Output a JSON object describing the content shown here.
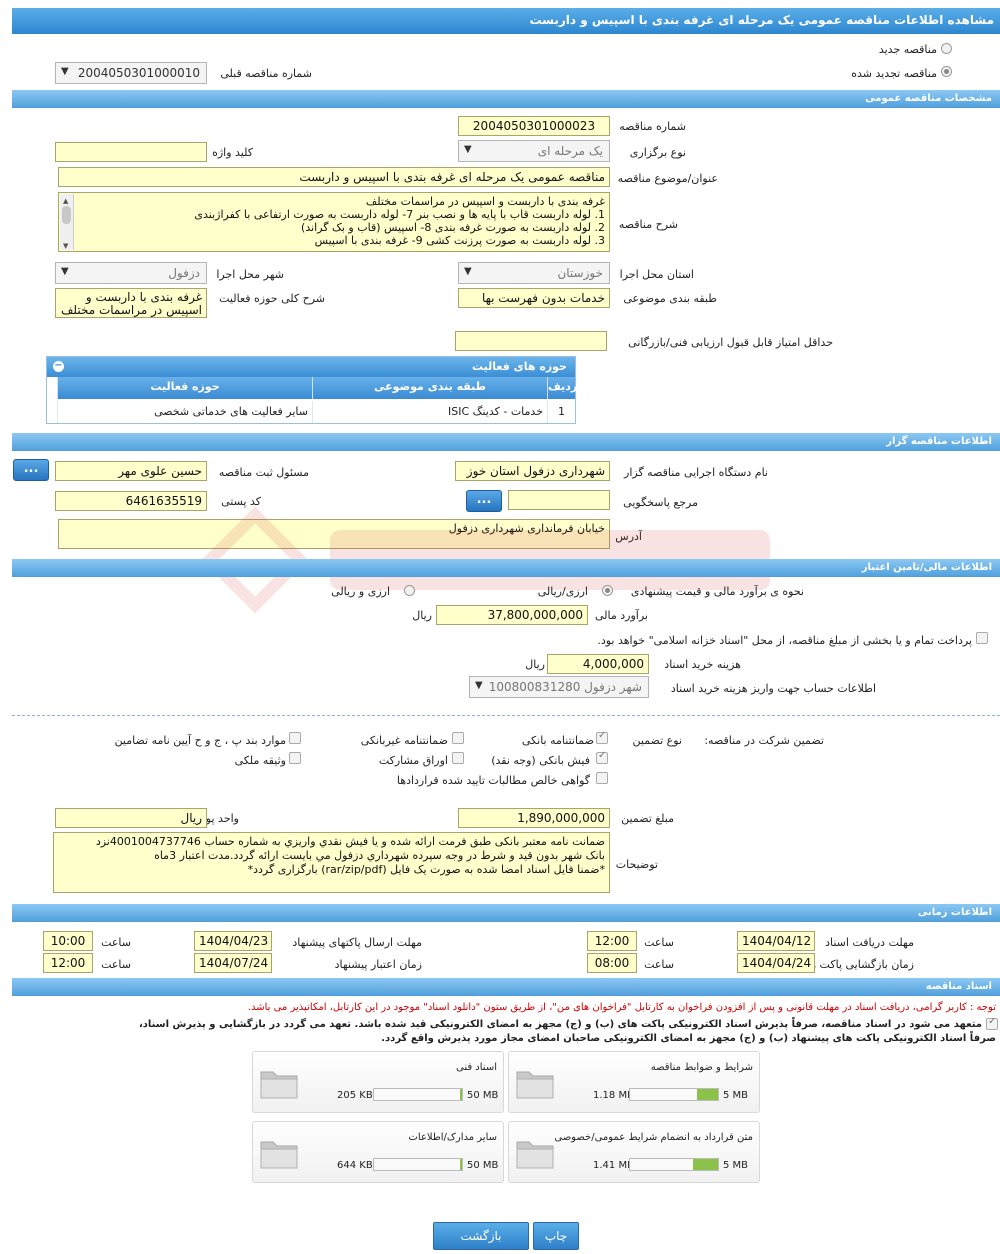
{
  "page": {
    "title": "مشاهده اطلاعات مناقصه عمومی یک مرحله ای غرفه بندی با اسپیس و داربست"
  },
  "tender_type": {
    "new_label": "مناقصه جدید",
    "renewed_label": "مناقصه تجدید شده",
    "prev_number_label": "شماره مناقصه قبلی",
    "prev_number_value": "2004050301000010"
  },
  "general": {
    "section_title": "مشخصات مناقصه عمومی",
    "number_label": "شماره مناقصه",
    "number_value": "2004050301000023",
    "holding_type_label": "نوع برگزاری",
    "holding_type_value": "یک مرحله ای",
    "keyword_label": "کلید واژه",
    "keyword_value": "",
    "subject_label": "عنوان/موضوع مناقصه",
    "subject_value": "مناقصه عمومی یک مرحله ای غرفه بندی با اسپیس و داربست",
    "description_label": "شرح مناقصه",
    "description_lines": [
      "غرفه بندی با داربست و اسپیس در مراسمات مختلف",
      "1.     لوله داربست قاب با پایه ها و نصب بنر       7-     لوله داربست به صورت ارتفاعی با کفراژبندی",
      "2.     لوله داربست به صورت غرفه بندی    8-      اسپیس (قاب و بک گراند)",
      "3.     لوله داربست به صورت پرزنت کشی  9-     غرفه بندی با اسپیس"
    ],
    "province_label": "استان محل اجرا",
    "province_value": "خوزستان",
    "city_label": "شهر محل اجرا",
    "city_value": "دزفول",
    "category_label": "طبقه بندی موضوعی",
    "category_value": "خدمات بدون فهرست بها",
    "activity_desc_label": "شرح کلی حوزه فعالیت",
    "activity_desc_lines": [
      "غرفه بندی با داربست و",
      "اسپیس در مراسمات مختلف"
    ],
    "min_score_label": "حداقل امتیاز قابل قبول ارزیابی فنی/بازرگانی",
    "min_score_value": ""
  },
  "activities": {
    "title": "حوزه های فعالیت",
    "columns": [
      "ردیف",
      "طبقه بندی موضوعی",
      "حوزه فعالیت"
    ],
    "rows": [
      {
        "index": "1",
        "category": "خدمات - کدینگ ISIC",
        "activity": "سایر فعالیت های خدماتی شخصی"
      }
    ]
  },
  "organizer": {
    "section_title": "اطلاعات مناقصه گزار",
    "org_label": "نام دستگاه اجرایی مناقصه گزار",
    "org_value": "شهرداری دزفول استان خوز",
    "responsible_label": "مسئول ثبت مناقصه",
    "responsible_value": "حسین علوی مهر",
    "reference_label": "مرجع پاسخگویی",
    "reference_value": "",
    "postal_label": "کد پستی",
    "postal_value": "6461635519",
    "address_label": "آدرس",
    "address_value": "خیابان فرمانداری شهرداری دزفول",
    "dots": "..."
  },
  "finance": {
    "section_title": "اطلاعات مالی/تامین اعتبار",
    "method_label": "نحوه ی برآورد مالی و قیمت پیشنهادی",
    "opt_currency_rial": "ارزی/ریالی",
    "opt_currency_and_rial": "ارزی و ریالی",
    "estimate_label": "برآورد مالی",
    "estimate_value": "37,800,000,000",
    "unit_rial": "ریال",
    "treasury_text": "پرداخت تمام و یا بخشی از مبلغ مناقصه، از محل \"اسناد خزانه اسلامی\" خواهد بود.",
    "doc_cost_label": "هزینه خرید اسناد",
    "doc_cost_value": "4,000,000",
    "account_label": "اطلاعات حساب جهت واریز هزینه خرید اسناد",
    "account_value": "شهر دزفول 100800831280"
  },
  "guarantee": {
    "participation_label": "تضمین شرکت در مناقصه:",
    "type_label": "نوع تضمین",
    "options": {
      "bank_guarantee": "ضمانتنامه بانکی",
      "non_bank_guarantee": "ضمانتنامه غیربانکی",
      "clauses": "موارد بند پ ، ج و ح آیین نامه تضامین",
      "bank_receipt": "فیش بانکی (وجه نقد)",
      "participation_papers": "اوراق مشارکت",
      "property_bond": "وثیقه ملکی",
      "receivables_cert": "گواهی خالص مطالبات تایید شده قراردادها"
    },
    "amount_label": "مبلغ تضمین",
    "amount_value": "1,890,000,000",
    "currency_label": "واحد پول",
    "currency_value": "ریال",
    "notes_label": "توضیحات",
    "notes_lines": [
      "ضمانت نامه معتبر بانکی طبق فرمت ارائه شده و یا  فیش نقدي واريزي  به شماره حساب  4001004737746نزد",
      "بانک شهر بدون قید و شرط در وجه سپرده  شهرداري دزفول  مي بايست ارائه گردد.مدت اعتبار 3ماه",
      "*ضمنا فایل اسناد امضا شده به صورت یک فایل (rar/zip/pdf) بارگزاری گردد*"
    ]
  },
  "timing": {
    "section_title": "اطلاعات زمانی",
    "time_label": "ساعت",
    "receive_deadline_label": "مهلت دریافت اسناد",
    "receive_deadline_date": "1404/04/12",
    "receive_deadline_time": "12:00",
    "send_deadline_label": "مهلت ارسال پاکتهای پیشنهاد",
    "send_deadline_date": "1404/04/23",
    "send_deadline_time": "10:00",
    "opening_label": "زمان بازگشایی پاکت ها",
    "opening_date": "1404/04/24",
    "opening_time": "08:00",
    "validity_label": "زمان اعتبار پیشنهاد",
    "validity_date": "1404/07/24",
    "validity_time": "12:00"
  },
  "documents": {
    "section_title": "اسناد مناقصه",
    "notice": "توجه : کاربر گرامی، دریافت اسناد در مهلت قانونی و پس از افزودن فراخوان به کارتابل \"فراخوان های من\"، از طریق ستون \"دانلود اسناد\" موجود در این کارتابل، امکانپذیر می باشد.",
    "commit_line1": "متعهد می شود در اسناد مناقصه، صرفاً پذیرش اسناد الکترونیکی پاکت های (ب) و (ج) مجهز به امضای الکترونیکی قید شده باشد. تعهد می گردد در بازگشایی و پذیرش اسناد،",
    "commit_line2": "صرفاً اسناد الکترونیکی پاکت های پیشنهاد (ب) و (ج) مجهز به امضای الکترونیکی صاحبان امضای مجاز مورد پذیرش واقع گردد.",
    "files": [
      {
        "name": "شرایط و ضوابط مناقصه",
        "size": "1.18 MB",
        "max": "5 MB",
        "fill": 0.24
      },
      {
        "name": "اسناد فنی",
        "size": "205 KB",
        "max": "50 MB",
        "fill": 0.01
      },
      {
        "name": "متن قرارداد به انضمام شرایط عمومی/خصوصی",
        "size": "1.41 MB",
        "max": "5 MB",
        "fill": 0.28
      },
      {
        "name": "سایر مدارک/اطلاعات",
        "size": "644 KB",
        "max": "50 MB",
        "fill": 0.01
      }
    ]
  },
  "actions": {
    "back_label": "بازگشت",
    "print_label": "چاپ"
  },
  "colors": {
    "header_blue": "#2d86cf",
    "field_yellow": "#ffffcc",
    "notice_red": "#d40000",
    "progress_green": "#8bc34a"
  }
}
